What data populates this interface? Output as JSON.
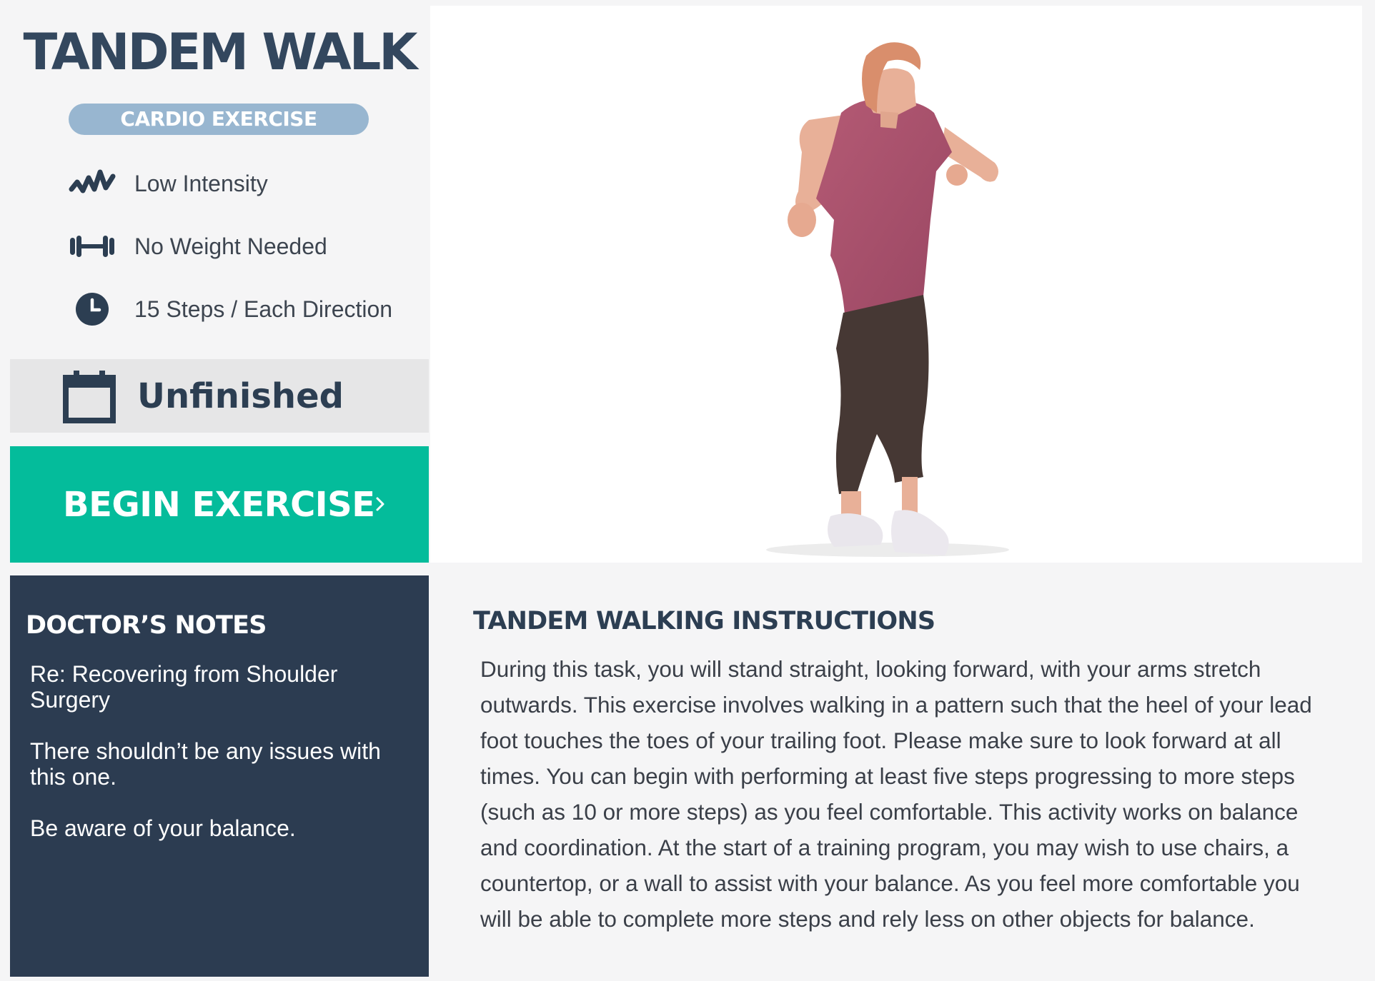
{
  "exercise": {
    "title": "TANDEM WALK",
    "category": "CARDIO EXERCISE",
    "features": [
      {
        "icon": "intensity-wave-icon",
        "label": "Low Intensity"
      },
      {
        "icon": "dumbbell-icon",
        "label": "No Weight Needed"
      },
      {
        "icon": "clock-icon",
        "label": "15 Steps / Each Direction"
      }
    ],
    "status": {
      "icon": "calendar-icon",
      "label": "Unfinished"
    },
    "begin_button": "BEGIN EXERCISE"
  },
  "doctors_notes": {
    "heading": "DOCTOR’S NOTES",
    "notes": [
      "Re: Recovering from Shoulder Surgery",
      "There shouldn’t be any issues with this one.",
      "Be aware of your balance."
    ]
  },
  "instructions": {
    "heading": "TANDEM WALKING INSTRUCTIONS",
    "body": "During this task, you will stand straight, looking forward, with your arms stretch outwards. This exercise involves walking in a pattern such that the heel of your lead foot touches the toes of your trailing foot. Please make sure to look forward at all times. You can begin with performing at least five steps progressing to more steps (such as 10 or more steps) as you feel comfortable. This activity works on balance and coordination. At the start of a training program, you may wish to use chairs, a countertop, or a wall to assist with your balance. As you feel more comfortable you will be able to complete more steps and rely less on other objects for balance."
  },
  "colors": {
    "accent": "#04bc9b",
    "navy": "#2c3c51",
    "badge": "#98b6d0"
  }
}
